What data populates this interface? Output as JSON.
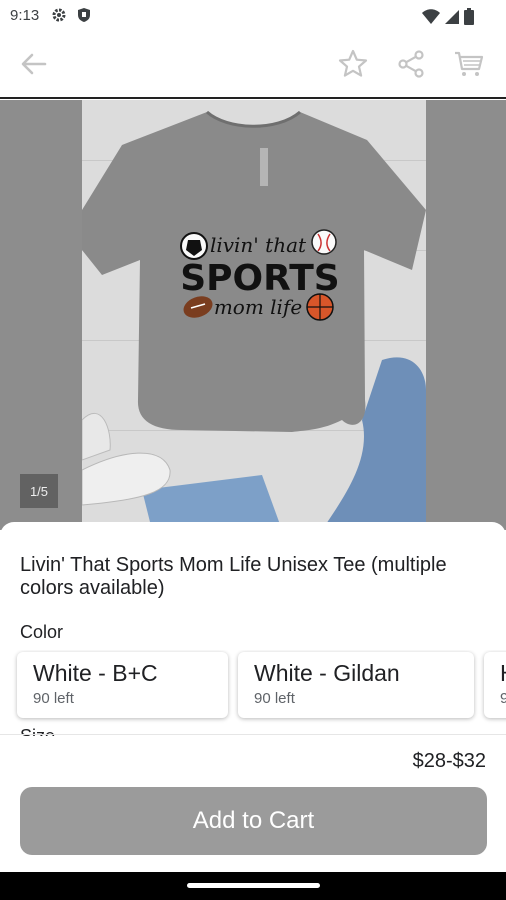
{
  "status_bar": {
    "time": "9:13",
    "icons": [
      "gear-icon",
      "shield-icon",
      "wifi-icon",
      "signal-icon",
      "battery-icon"
    ]
  },
  "toolbar": {
    "icons": [
      "arrow-back-icon",
      "star-icon",
      "share-icon",
      "cart-icon"
    ]
  },
  "gallery": {
    "counter": "1/5",
    "shirt_text": [
      "livin' that",
      "SPORTS",
      "mom life"
    ]
  },
  "product": {
    "title": "Livin' That Sports Mom Life Unisex Tee (multiple colors available)",
    "color_label": "Color",
    "colors": [
      {
        "name": "White - B+C",
        "stock": "90 left"
      },
      {
        "name": "White - Gildan",
        "stock": "90 left"
      },
      {
        "name": "H",
        "stock": "9"
      }
    ],
    "size_label": "Size",
    "price": "$28-$32",
    "add_to_cart": "Add to Cart"
  },
  "colors": {
    "button_bg": "#9b9b9b",
    "image_bg": "#8d8d8d",
    "shirt": "#8a8a8a"
  }
}
